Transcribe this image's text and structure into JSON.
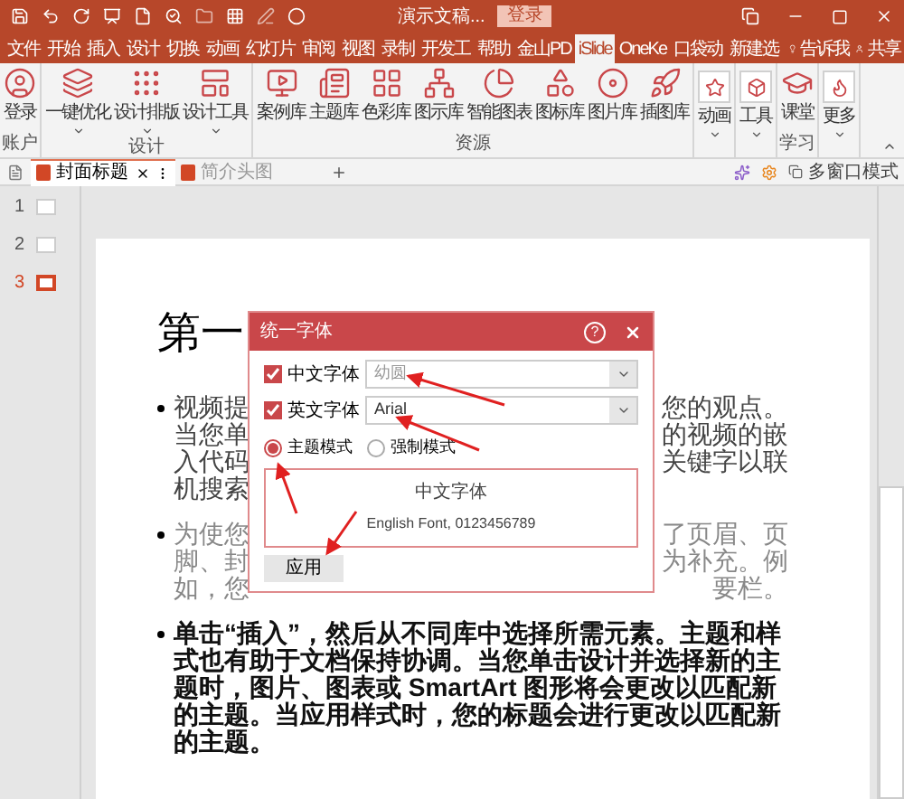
{
  "title_bar": {
    "title": "演示文稿...",
    "login": "登录"
  },
  "menu_tabs": [
    {
      "label": "文件",
      "selected": false
    },
    {
      "label": "开始",
      "selected": false
    },
    {
      "label": "插入",
      "selected": false
    },
    {
      "label": "设计",
      "selected": false
    },
    {
      "label": "切换",
      "selected": false
    },
    {
      "label": "动画",
      "selected": false
    },
    {
      "label": "幻灯片",
      "selected": false
    },
    {
      "label": "审阅",
      "selected": false
    },
    {
      "label": "视图",
      "selected": false
    },
    {
      "label": "录制",
      "selected": false
    },
    {
      "label": "开发工",
      "selected": false
    },
    {
      "label": "帮助",
      "selected": false
    },
    {
      "label": "金山PD",
      "selected": false
    },
    {
      "label": "iSlide",
      "selected": true
    },
    {
      "label": "OneKe",
      "selected": false
    },
    {
      "label": "口袋动",
      "selected": false
    },
    {
      "label": "新建选",
      "selected": false
    }
  ],
  "tell_me": "告诉我",
  "share": "共享",
  "ribbon": {
    "groups": [
      {
        "label": "账户",
        "items": [
          {
            "label": "登录",
            "dropdown": false,
            "kind": "plain"
          }
        ]
      },
      {
        "label": "设计",
        "items": [
          {
            "label": "一键优化",
            "dropdown": true,
            "kind": "plain"
          },
          {
            "label": "设计排版",
            "dropdown": true,
            "kind": "plain"
          },
          {
            "label": "设计工具",
            "dropdown": true,
            "kind": "plain"
          }
        ]
      },
      {
        "label": "资源",
        "items": [
          {
            "label": "案例库",
            "dropdown": false,
            "kind": "plain"
          },
          {
            "label": "主题库",
            "dropdown": false,
            "kind": "plain"
          },
          {
            "label": "色彩库",
            "dropdown": false,
            "kind": "plain"
          },
          {
            "label": "图示库",
            "dropdown": false,
            "kind": "plain"
          },
          {
            "label": "智能图表",
            "dropdown": false,
            "kind": "plain"
          },
          {
            "label": "图标库",
            "dropdown": false,
            "kind": "plain"
          },
          {
            "label": "图片库",
            "dropdown": false,
            "kind": "plain"
          },
          {
            "label": "插图库",
            "dropdown": false,
            "kind": "plain"
          }
        ]
      },
      {
        "items": [
          {
            "label": "动画",
            "dropdown": true,
            "kind": "boxed"
          }
        ]
      },
      {
        "items": [
          {
            "label": "工具",
            "dropdown": true,
            "kind": "boxed"
          }
        ]
      },
      {
        "label": "学习",
        "items": [
          {
            "label": "课堂",
            "dropdown": false,
            "kind": "plain"
          }
        ]
      },
      {
        "items": [
          {
            "label": "更多",
            "dropdown": true,
            "kind": "boxed"
          }
        ]
      }
    ]
  },
  "doc_tabs": [
    {
      "label": "封面标题",
      "selected": true
    },
    {
      "label": "简介头图",
      "selected": false
    }
  ],
  "multi_window": "多窗口模式",
  "slides": [
    {
      "number": "1",
      "selected": false
    },
    {
      "number": "2",
      "selected": false
    },
    {
      "number": "3",
      "selected": true
    }
  ],
  "slide": {
    "title": "第一",
    "paragraphs": [
      {
        "kind": "fragments",
        "lines": [
          {
            "left": "视频提",
            "right": "您的观点。"
          },
          {
            "left": "当您单",
            "right": "的视频的嵌"
          },
          {
            "left": "入代码",
            "right": "关键字以联"
          },
          {
            "left": "机搜索"
          }
        ]
      },
      {
        "kind": "muted",
        "lines": [
          {
            "left": "为使您",
            "right": "了页眉、页"
          },
          {
            "left": "脚、封",
            "right": "为补充。例"
          },
          {
            "left": "如，您",
            "right": "要栏。"
          }
        ]
      },
      {
        "kind": "bold",
        "text": "单击“插入”，然后从不同库中选择所需元素。主题和样式也有助于文档保持协调。当您单击设计并选择新的主题时，图片、图表或 SmartArt 图形将会更改以匹配新的主题。当应用样式时，您的标题会进行更改以匹配新的主题。"
      }
    ]
  },
  "dialog": {
    "title": "统一字体",
    "help": "?",
    "fonts": [
      {
        "label": "中文字体",
        "checked": true,
        "value": "幼圆"
      },
      {
        "label": "英文字体",
        "checked": true,
        "value": "Arial"
      }
    ],
    "modes": [
      {
        "label": "主题模式",
        "selected": true
      },
      {
        "label": "强制模式",
        "selected": false
      }
    ],
    "preview": [
      "中文字体",
      "English Font, 0123456789"
    ],
    "apply": "应用"
  }
}
